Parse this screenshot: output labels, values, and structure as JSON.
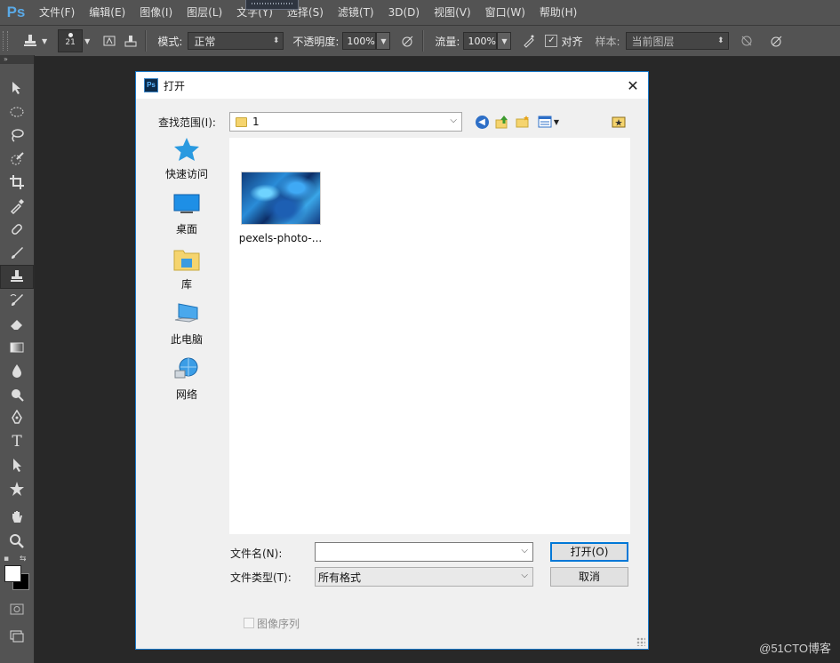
{
  "app": {
    "logo": "Ps"
  },
  "menu": [
    "文件(F)",
    "编辑(E)",
    "图像(I)",
    "图层(L)",
    "文字(Y)",
    "选择(S)",
    "滤镜(T)",
    "3D(D)",
    "视图(V)",
    "窗口(W)",
    "帮助(H)"
  ],
  "options_bar": {
    "brush_size": "21",
    "mode_label": "模式:",
    "mode_value": "正常",
    "opacity_label": "不透明度:",
    "opacity_value": "100%",
    "flow_label": "流量:",
    "flow_value": "100%",
    "aligned_label": "对齐",
    "aligned_checked": "✓",
    "sample_label": "样本:",
    "sample_value": "当前图层"
  },
  "dialog": {
    "title": "打开",
    "title_icon": "Ps",
    "close": "✕",
    "lookin_label": "查找范围(I):",
    "lookin_value": "1",
    "places": [
      {
        "label": "快速访问",
        "icon": "star-icon"
      },
      {
        "label": "桌面",
        "icon": "desktop-icon"
      },
      {
        "label": "库",
        "icon": "library-icon"
      },
      {
        "label": "此电脑",
        "icon": "computer-icon"
      },
      {
        "label": "网络",
        "icon": "network-icon"
      }
    ],
    "files": [
      {
        "name": "pexels-photo-..."
      }
    ],
    "filename_label": "文件名(N):",
    "filename_value": "",
    "filetype_label": "文件类型(T):",
    "filetype_value": "所有格式",
    "open_button": "打开(O)",
    "cancel_button": "取消",
    "sequence_label": "图像序列"
  },
  "watermark": "@51CTO博客",
  "colors": {
    "ps_blue": "#5aa9e6",
    "dialog_border": "#1979ca",
    "folder": "#f5d46e"
  }
}
